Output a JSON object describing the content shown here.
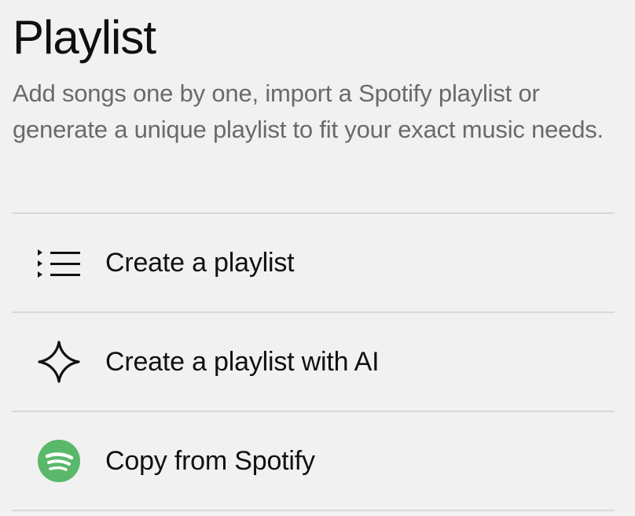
{
  "header": {
    "title": "Playlist",
    "subtitle": "Add songs one by one, import a Spotify playlist or generate a unique playlist to fit your exact music needs."
  },
  "menu": {
    "items": [
      {
        "label": "Create a playlist",
        "icon": "playlist-icon"
      },
      {
        "label": "Create a playlist with AI",
        "icon": "ai-sparkle-icon"
      },
      {
        "label": "Copy from Spotify",
        "icon": "spotify-icon"
      }
    ]
  },
  "colors": {
    "background": "#f1f1f1",
    "text": "#111111",
    "muted_text": "#6a6a6a",
    "divider": "#d8d8d8",
    "spotify_green": "#59b86a"
  }
}
